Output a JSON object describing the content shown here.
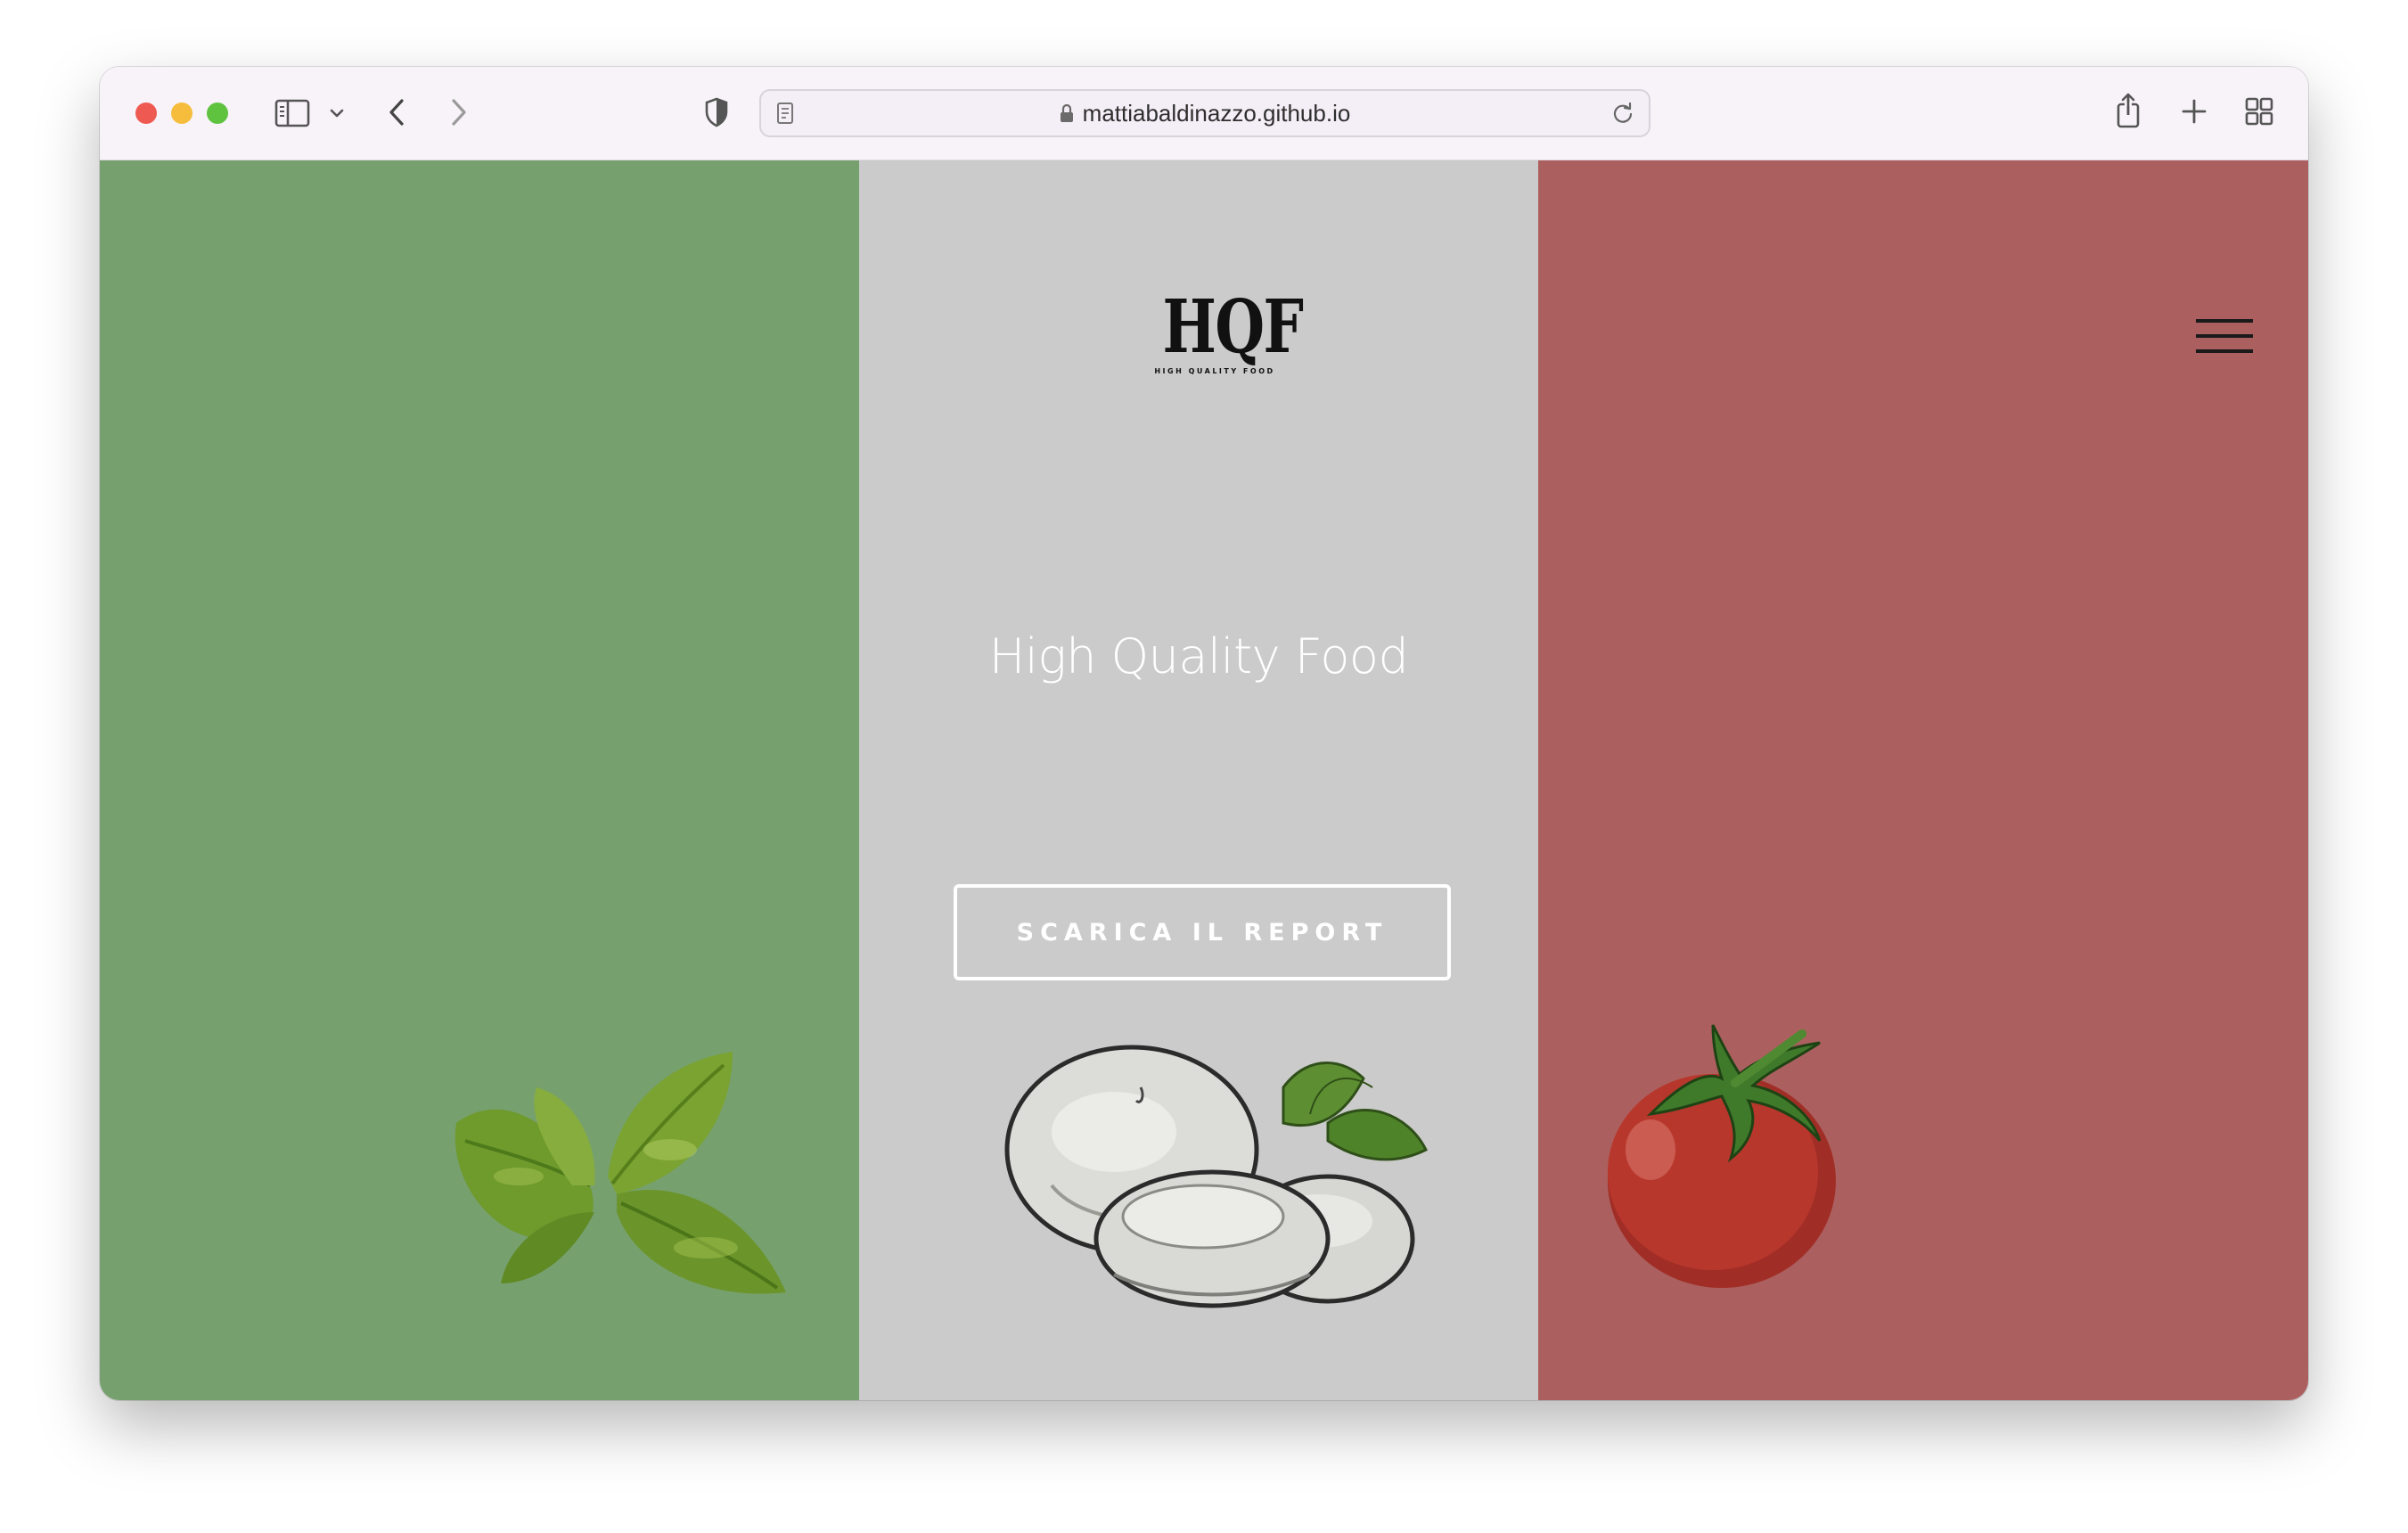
{
  "browser": {
    "url": "mattiabaldinazzo.github.io",
    "traffic_lights": {
      "close": "#ee5a52",
      "minimize": "#f5bd3b",
      "maximize": "#5fc33f"
    }
  },
  "page": {
    "panel_colors": {
      "green": "#77a06f",
      "gray": "#cbcbcb",
      "red": "#ab605f"
    },
    "logo": {
      "main": "HQF",
      "sub": "HIGH QUALITY FOOD"
    },
    "headline": "High Quality Food",
    "cta_label": "SCARICA IL REPORT",
    "illustrations": {
      "left": "basil-leaves",
      "center": "mozzarella-with-basil",
      "right": "tomato"
    }
  }
}
